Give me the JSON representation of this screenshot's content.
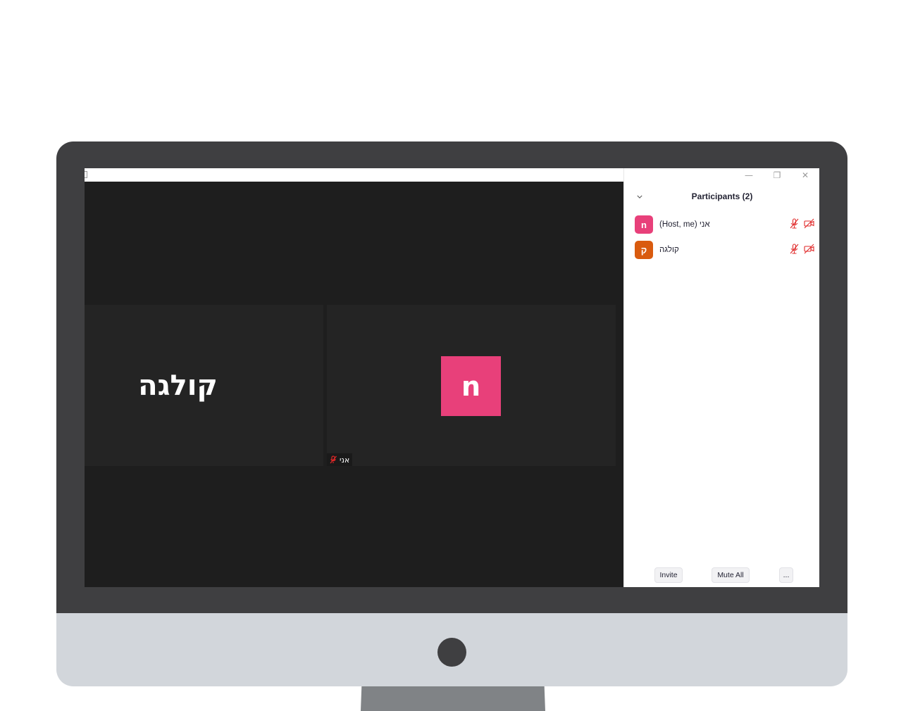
{
  "colors": {
    "avatar_self": "#e8407a",
    "avatar_colleague": "#d95b0f",
    "muted_icon": "#e02828",
    "video_bg": "#1e1e1e",
    "tile_bg": "#242424"
  },
  "gallery": {
    "tiles": [
      {
        "name": "קולגה"
      },
      {
        "avatar_letter": "n",
        "label": "אני",
        "icon": "mic-muted-icon"
      }
    ]
  },
  "window": {
    "controls": {
      "minimize": "—",
      "restore": "❐",
      "close": "✕"
    }
  },
  "participants_panel": {
    "title": "Participants (2)",
    "collapse_icon": "chevron-down-icon",
    "participants": [
      {
        "avatar_letter": "n",
        "name": "אני (Host, me)",
        "mic": "muted",
        "video": "off"
      },
      {
        "avatar_letter": "ק",
        "name": "קולגה",
        "mic": "muted",
        "video": "off"
      }
    ],
    "footer": {
      "invite": "Invite",
      "mute_all": "Mute All",
      "more": "..."
    }
  }
}
